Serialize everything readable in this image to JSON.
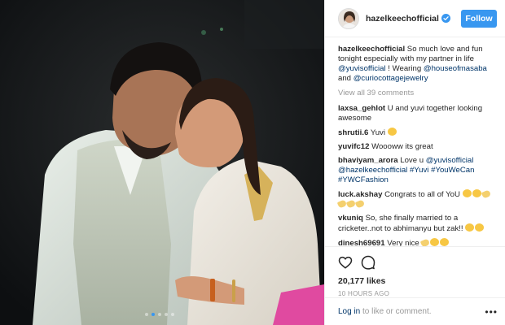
{
  "post": {
    "username": "hazelkeechofficial",
    "follow_label": "Follow",
    "caption": {
      "user": "hazelkeechofficial",
      "text1": "So much love and fun tonight especially with my partner in life",
      "mention1": "@yuvisofficial",
      "text2": "! Wearing",
      "mention2": "@houseofmasaba",
      "text3": "and",
      "mention3": "@curiocottagejewelry"
    },
    "view_all": "View all 39 comments",
    "comments": [
      {
        "user": "laxsa_gehlot",
        "text": "U and yuvi together looking awesome"
      },
      {
        "user": "shrutii.6",
        "text": "Yuvi"
      },
      {
        "user": "yuvifc12",
        "text": "Woooww its great"
      },
      {
        "user": "bhaviyam_arora",
        "text1": "Love u",
        "mention1": "@yuvisofficial",
        "mention2": "@hazelkeechofficial",
        "tags": "#Yuvi #YouWeCan #YWCFashion"
      },
      {
        "user": "luck.akshay",
        "text": "Congrats to all of YoU"
      },
      {
        "user": "vkuniq",
        "text": "So, she finally married to a cricketer..not to abhimanyu but zak!!"
      },
      {
        "user": "dinesh69691",
        "text": "Very nice"
      }
    ],
    "likes": "20,177 likes",
    "time": "10 HOURS AGO",
    "login": {
      "link": "Log in",
      "text": "to like or comment."
    },
    "more_label": "•••"
  },
  "icons": {
    "verified": "verified-badge-icon",
    "like": "heart-icon",
    "comment": "comment-bubble-icon",
    "more": "more-options-icon"
  },
  "colors": {
    "accent": "#3897f0",
    "link": "#003569",
    "muted": "#999999"
  }
}
